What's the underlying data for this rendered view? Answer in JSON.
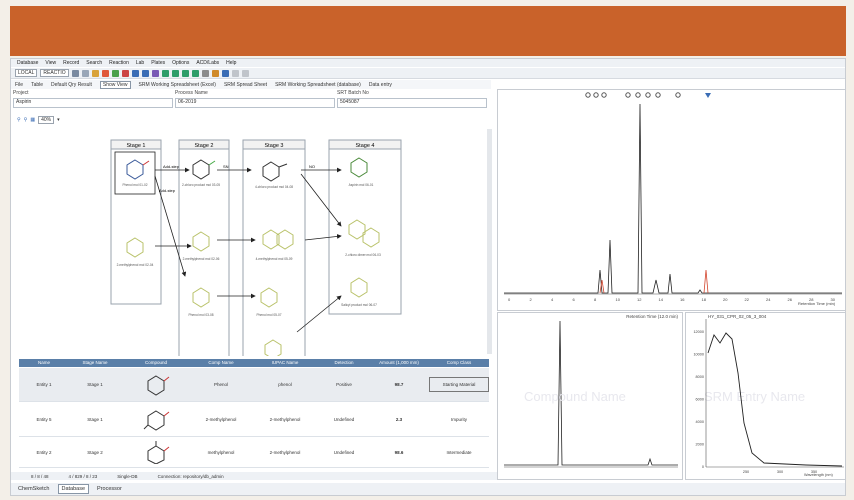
{
  "menu": [
    "Database",
    "View",
    "Record",
    "Search",
    "Reaction",
    "Lab",
    "Plates",
    "Options",
    "ACD/Labs",
    "Help"
  ],
  "toolbar": {
    "local": "LOCAL",
    "reactio": "REACTIO"
  },
  "nav": [
    "File",
    "Table",
    "Default Qry Result",
    "Show View",
    "SRM Working Spreadsheet (Excel)",
    "SRM Spread Sheet",
    "SRM Working Spreadsheet (database)",
    "Data entry"
  ],
  "fields": [
    {
      "label": "Project",
      "value": "Aspirin"
    },
    {
      "label": "Process Name",
      "value": "06-2019"
    },
    {
      "label": "SRT Batch No",
      "value": "5045087"
    }
  ],
  "zoom": "40%",
  "stages": [
    {
      "title": "Stage 1"
    },
    {
      "title": "Stage 2"
    },
    {
      "title": "Stage 3"
    },
    {
      "title": "Stage 4"
    }
  ],
  "arrows": {
    "a1": "Add-step",
    "a2": "Add-step",
    "a3": "SN",
    "a4": "NO"
  },
  "mol_labels": {
    "s1a": "Phenol\nmol 01-02",
    "s1b": "2-methylphenol\nmol 02-04",
    "s2a": "2-chloro product\nmol 03-05",
    "s2b": "2-methylphenol\nmol 02-06",
    "s2c": "Phenol\nmol 03-08",
    "s3a": "4-chloro product\nmol 04-08",
    "s3b": "4-methylphenol\nmol 05-09",
    "s3c": "Phenol\nmol 05-07",
    "s4a": "Aspirin\nmol 06-01",
    "s4b": "2-chloro dimer\nmol 06-03",
    "s4c": "Salicyl product\nmol 06-07"
  },
  "table": {
    "headers": [
      "Name",
      "Stage Name",
      "Compound",
      "Comp Name",
      "IUPAC Name",
      "Detection",
      "Amount (1,000 mm)",
      "Comp Class"
    ],
    "rows": [
      {
        "name": "Entity 1",
        "stage": "Stage 1",
        "comp": "Phenol",
        "iupac": "phenol",
        "det": "Positive",
        "amount": "98.7",
        "cls": "Starting Material"
      },
      {
        "name": "Entity 5",
        "stage": "Stage 1",
        "comp": "2-methylphenol",
        "iupac": "2-methylphenol",
        "det": "Undefined",
        "amount": "2.3",
        "cls": "Impurity"
      },
      {
        "name": "Entity 2",
        "stage": "Stage 2",
        "comp": "methylphenol",
        "iupac": "2-methylphenol",
        "det": "Undefined",
        "amount": "98.6",
        "cls": "Intermediate"
      }
    ]
  },
  "status": {
    "left": "8 / 8 / 48",
    "mid": "4 / 829 / 8 / 23",
    "single": "Single-DB",
    "conn": "Connection: repository/db_admin"
  },
  "tabs": [
    "ChemSketch",
    "Database",
    "Processor"
  ],
  "panels": {
    "top_axis": "Retention Time (min)",
    "bottom_left_title": "Retention Time (12.0 min)",
    "bottom_right_title": "HY_031_CPR_02_05_3_004",
    "watermark_left": "Compound Name",
    "watermark_right": "SRM Entry Name",
    "wl_axis": "Wavelength (nm)"
  },
  "chrom_ticks": [
    "0",
    "2",
    "4",
    "6",
    "8",
    "10",
    "12",
    "14",
    "16",
    "18",
    "20",
    "22",
    "24",
    "26",
    "28",
    "30"
  ],
  "uv_y": [
    "12000",
    "10000",
    "8000",
    "6000",
    "4000",
    "2000",
    "0"
  ],
  "uv_x": [
    "250",
    "300",
    "350"
  ],
  "colors": {
    "banner": "#c9622a",
    "header": "#5a7fa8",
    "molecule": "#7aa02f"
  }
}
